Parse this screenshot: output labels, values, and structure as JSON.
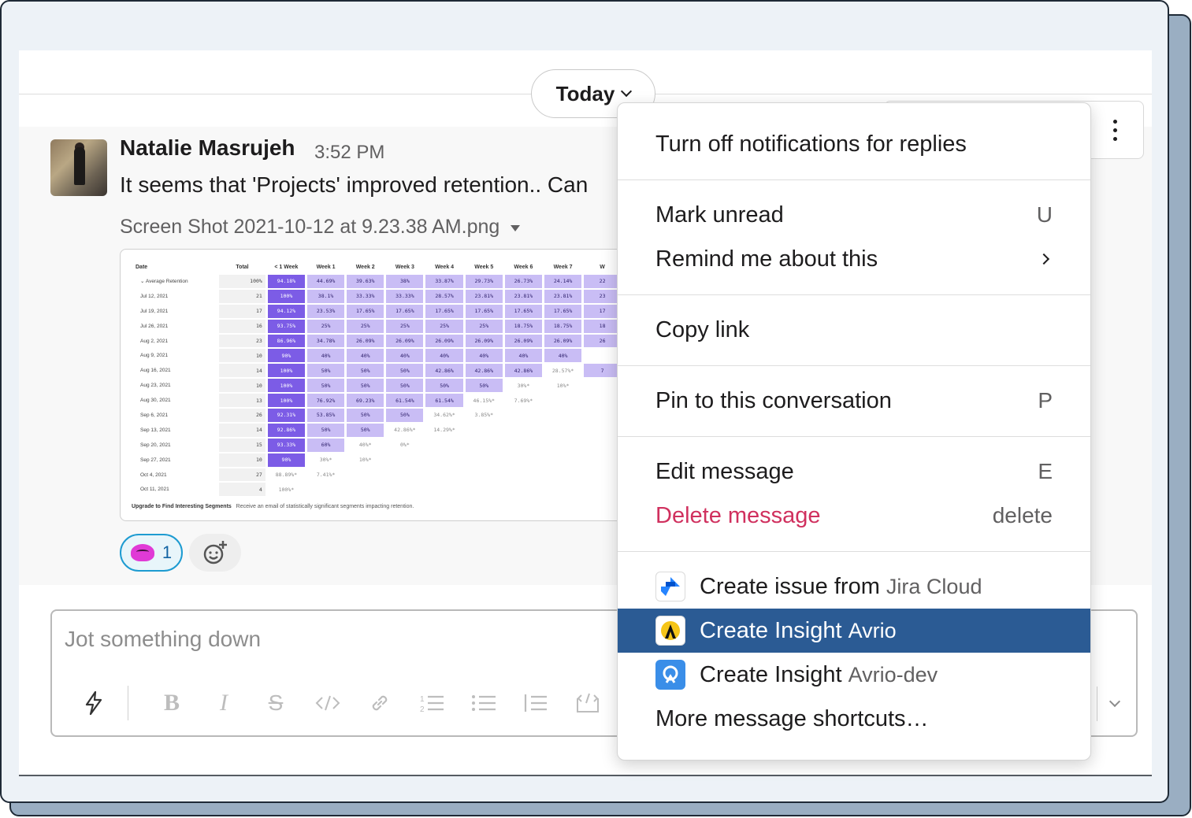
{
  "divider": {
    "date_label": "Today"
  },
  "message": {
    "author": "Natalie Masrujeh",
    "time": "3:52 PM",
    "text": "It seems that 'Projects' improved retention.. Can",
    "file_name": "Screen Shot 2021-10-12 at 9.23.38 AM.png",
    "reaction_count": "1",
    "attachment": {
      "headers": [
        "Date",
        "Total",
        "< 1 Week",
        "Week 1",
        "Week 2",
        "Week 3",
        "Week 4",
        "Week 5",
        "Week 6",
        "Week 7",
        "W"
      ],
      "rows": [
        {
          "date": "Average Retention",
          "cells": [
            "100%",
            "94.18%",
            "44.69%",
            "39.63%",
            "38%",
            "33.87%",
            "29.73%",
            "26.73%",
            "24.14%",
            "22"
          ]
        },
        {
          "date": "Jul 12, 2021",
          "cells": [
            "21",
            "100%",
            "38.1%",
            "33.33%",
            "33.33%",
            "28.57%",
            "23.81%",
            "23.81%",
            "23.81%",
            "23"
          ]
        },
        {
          "date": "Jul 19, 2021",
          "cells": [
            "17",
            "94.12%",
            "23.53%",
            "17.65%",
            "17.65%",
            "17.65%",
            "17.65%",
            "17.65%",
            "17.65%",
            "17"
          ]
        },
        {
          "date": "Jul 26, 2021",
          "cells": [
            "16",
            "93.75%",
            "25%",
            "25%",
            "25%",
            "25%",
            "25%",
            "18.75%",
            "18.75%",
            "18"
          ]
        },
        {
          "date": "Aug 2, 2021",
          "cells": [
            "23",
            "86.96%",
            "34.78%",
            "26.09%",
            "26.09%",
            "26.09%",
            "26.09%",
            "26.09%",
            "26.09%",
            "26"
          ]
        },
        {
          "date": "Aug 9, 2021",
          "cells": [
            "10",
            "90%",
            "40%",
            "40%",
            "40%",
            "40%",
            "40%",
            "40%",
            "40%",
            ""
          ]
        },
        {
          "date": "Aug 16, 2021",
          "cells": [
            "14",
            "100%",
            "50%",
            "50%",
            "50%",
            "42.86%",
            "42.86%",
            "42.86%",
            "28.57%*",
            "7"
          ]
        },
        {
          "date": "Aug 23, 2021",
          "cells": [
            "10",
            "100%",
            "50%",
            "50%",
            "50%",
            "50%",
            "50%",
            "30%*",
            "10%*",
            ""
          ]
        },
        {
          "date": "Aug 30, 2021",
          "cells": [
            "13",
            "100%",
            "76.92%",
            "69.23%",
            "61.54%",
            "61.54%",
            "46.15%*",
            "7.69%*",
            "",
            ""
          ]
        },
        {
          "date": "Sep 6, 2021",
          "cells": [
            "26",
            "92.31%",
            "53.85%",
            "50%",
            "50%",
            "34.62%*",
            "3.85%*",
            "",
            "",
            ""
          ]
        },
        {
          "date": "Sep 13, 2021",
          "cells": [
            "14",
            "92.86%",
            "50%",
            "50%",
            "42.86%*",
            "14.29%*",
            "",
            "",
            "",
            ""
          ]
        },
        {
          "date": "Sep 20, 2021",
          "cells": [
            "15",
            "93.33%",
            "60%",
            "40%*",
            "0%*",
            "",
            "",
            "",
            "",
            ""
          ]
        },
        {
          "date": "Sep 27, 2021",
          "cells": [
            "10",
            "90%",
            "30%*",
            "10%*",
            "",
            "",
            "",
            "",
            "",
            ""
          ]
        },
        {
          "date": "Oct 4, 2021",
          "cells": [
            "27",
            "88.89%*",
            "7.41%*",
            "",
            "",
            "",
            "",
            "",
            "",
            ""
          ]
        },
        {
          "date": "Oct 11, 2021",
          "cells": [
            "4",
            "100%*",
            "",
            "",
            "",
            "",
            "",
            "",
            "",
            ""
          ]
        }
      ],
      "footer_bold": "Upgrade to Find Interesting Segments",
      "footer_text": "Receive an email of statistically significant segments impacting retention."
    }
  },
  "composer": {
    "placeholder": "Jot something down"
  },
  "menu": {
    "turn_off_notifications": "Turn off notifications for replies",
    "mark_unread": "Mark unread",
    "mark_unread_key": "U",
    "remind_me": "Remind me about this",
    "copy_link": "Copy link",
    "pin": "Pin to this conversation",
    "pin_key": "P",
    "edit": "Edit message",
    "edit_key": "E",
    "delete": "Delete message",
    "delete_key": "delete",
    "jira_action": "Create issue from",
    "jira_app": "Jira Cloud",
    "avrio_action": "Create Insight",
    "avrio_app": "Avrio",
    "avrio_dev_action": "Create Insight",
    "avrio_dev_app": "Avrio-dev",
    "more_shortcuts": "More message shortcuts…"
  },
  "colors": {
    "highlight": "#2b5b94",
    "danger": "#d0305e",
    "retention_strong": "#7c5ce6",
    "retention_light": "#c9bdf5"
  }
}
